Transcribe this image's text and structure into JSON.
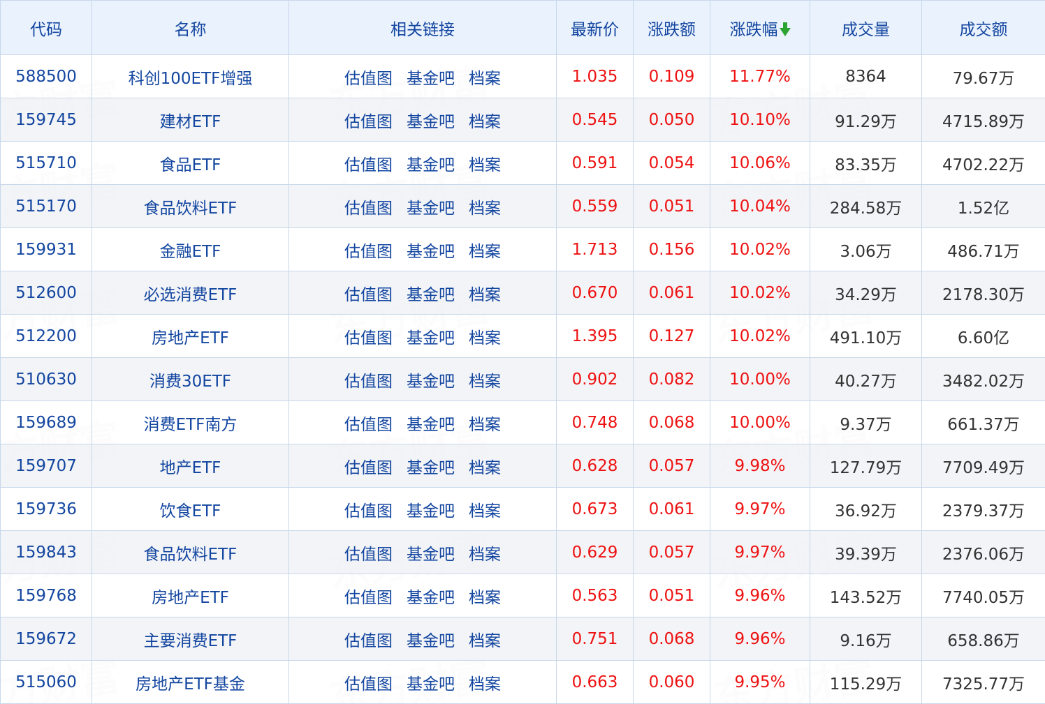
{
  "table": {
    "headers": {
      "code": "代码",
      "name": "名称",
      "links": "相关链接",
      "price": "最新价",
      "change": "涨跌额",
      "change_pct": "涨跌幅",
      "volume": "成交量",
      "amount": "成交额"
    },
    "sort": {
      "column": "change_pct",
      "direction": "desc",
      "arrow_color": "#2ba330"
    },
    "link_labels": {
      "valuation": "估值图",
      "forum": "基金吧",
      "profile": "档案"
    },
    "watermark_text": "东方财富",
    "colors": {
      "header_bg": "#eaf2fd",
      "blue_text": "#1346a0",
      "red_text": "#ee1111",
      "border": "#c7d7ea",
      "alt_row": "#f2f3f6"
    },
    "rows": [
      {
        "code": "588500",
        "name": "科创100ETF增强",
        "price": "1.035",
        "change": "0.109",
        "change_pct": "11.77%",
        "volume": "8364",
        "amount": "79.67万"
      },
      {
        "code": "159745",
        "name": "建材ETF",
        "price": "0.545",
        "change": "0.050",
        "change_pct": "10.10%",
        "volume": "91.29万",
        "amount": "4715.89万"
      },
      {
        "code": "515710",
        "name": "食品ETF",
        "price": "0.591",
        "change": "0.054",
        "change_pct": "10.06%",
        "volume": "83.35万",
        "amount": "4702.22万"
      },
      {
        "code": "515170",
        "name": "食品饮料ETF",
        "price": "0.559",
        "change": "0.051",
        "change_pct": "10.04%",
        "volume": "284.58万",
        "amount": "1.52亿"
      },
      {
        "code": "159931",
        "name": "金融ETF",
        "price": "1.713",
        "change": "0.156",
        "change_pct": "10.02%",
        "volume": "3.06万",
        "amount": "486.71万"
      },
      {
        "code": "512600",
        "name": "必选消费ETF",
        "price": "0.670",
        "change": "0.061",
        "change_pct": "10.02%",
        "volume": "34.29万",
        "amount": "2178.30万"
      },
      {
        "code": "512200",
        "name": "房地产ETF",
        "price": "1.395",
        "change": "0.127",
        "change_pct": "10.02%",
        "volume": "491.10万",
        "amount": "6.60亿"
      },
      {
        "code": "510630",
        "name": "消费30ETF",
        "price": "0.902",
        "change": "0.082",
        "change_pct": "10.00%",
        "volume": "40.27万",
        "amount": "3482.02万"
      },
      {
        "code": "159689",
        "name": "消费ETF南方",
        "price": "0.748",
        "change": "0.068",
        "change_pct": "10.00%",
        "volume": "9.37万",
        "amount": "661.37万"
      },
      {
        "code": "159707",
        "name": "地产ETF",
        "price": "0.628",
        "change": "0.057",
        "change_pct": "9.98%",
        "volume": "127.79万",
        "amount": "7709.49万"
      },
      {
        "code": "159736",
        "name": "饮食ETF",
        "price": "0.673",
        "change": "0.061",
        "change_pct": "9.97%",
        "volume": "36.92万",
        "amount": "2379.37万"
      },
      {
        "code": "159843",
        "name": "食品饮料ETF",
        "price": "0.629",
        "change": "0.057",
        "change_pct": "9.97%",
        "volume": "39.39万",
        "amount": "2376.06万"
      },
      {
        "code": "159768",
        "name": "房地产ETF",
        "price": "0.563",
        "change": "0.051",
        "change_pct": "9.96%",
        "volume": "143.52万",
        "amount": "7740.05万"
      },
      {
        "code": "159672",
        "name": "主要消费ETF",
        "price": "0.751",
        "change": "0.068",
        "change_pct": "9.96%",
        "volume": "9.16万",
        "amount": "658.86万"
      },
      {
        "code": "515060",
        "name": "房地产ETF基金",
        "price": "0.663",
        "change": "0.060",
        "change_pct": "9.95%",
        "volume": "115.29万",
        "amount": "7325.77万"
      }
    ]
  }
}
